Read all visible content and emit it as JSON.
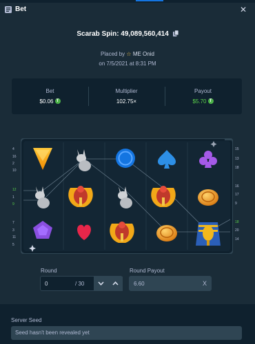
{
  "header": {
    "title": "Bet",
    "close_glyph": "✕"
  },
  "spin": {
    "label": "Scarab Spin: 49,089,560,414"
  },
  "placed": {
    "prefix": "Placed by",
    "username": "ME Onid",
    "datetime": "on 7/5/2021 at 8:31 PM"
  },
  "stats": {
    "bet": {
      "label": "Bet",
      "value": "$0.06"
    },
    "multiplier": {
      "label": "Multiplier",
      "value": "102.75×"
    },
    "payout": {
      "label": "Payout",
      "value": "$5.70"
    },
    "currency_glyph": "T"
  },
  "board": {
    "left_numbers": [
      {
        "text": "4",
        "green": false
      },
      {
        "text": "16",
        "green": false
      },
      {
        "text": "2",
        "green": false
      },
      {
        "text": "10",
        "green": false
      },
      {
        "text": "12",
        "green": true
      },
      {
        "text": "1",
        "green": false
      },
      {
        "text": "9",
        "green": true
      },
      {
        "text": "7",
        "green": false
      },
      {
        "text": "3",
        "green": false
      },
      {
        "text": "11",
        "green": false
      },
      {
        "text": "5",
        "green": false
      }
    ],
    "right_numbers": [
      {
        "text": "15",
        "green": false
      },
      {
        "text": "13",
        "green": false
      },
      {
        "text": "18",
        "green": false
      },
      {
        "text": "16",
        "green": false
      },
      {
        "text": "17",
        "green": false
      },
      {
        "text": "9",
        "green": false
      },
      {
        "text": "18",
        "green": true
      },
      {
        "text": "20",
        "green": false
      },
      {
        "text": "14",
        "green": false
      }
    ],
    "grid": [
      [
        "triangle-gem-icon",
        "jackal-statue-icon",
        "blue-ring-icon",
        "spade-icon",
        "club-icon"
      ],
      [
        "jackal-statue-icon",
        "scarab-icon",
        "jackal-statue-icon",
        "scarab-icon",
        "gold-coin-icon"
      ],
      [
        "pentagon-gem-icon",
        "heart-icon",
        "scarab-icon",
        "gold-coin-icon",
        "pharaoh-mask-icon"
      ]
    ]
  },
  "round": {
    "label": "Round",
    "value": "0",
    "total": "/ 30"
  },
  "round_payout": {
    "label": "Round Payout",
    "value": "6.60",
    "suffix": "X"
  },
  "server_seed": {
    "label": "Server Seed",
    "placeholder": "Seed hasn't been revealed yet"
  },
  "colors": {
    "bg": "#1a2c38",
    "panel": "#0f212e",
    "green": "#5cd34a",
    "muted": "#b1bad3"
  }
}
